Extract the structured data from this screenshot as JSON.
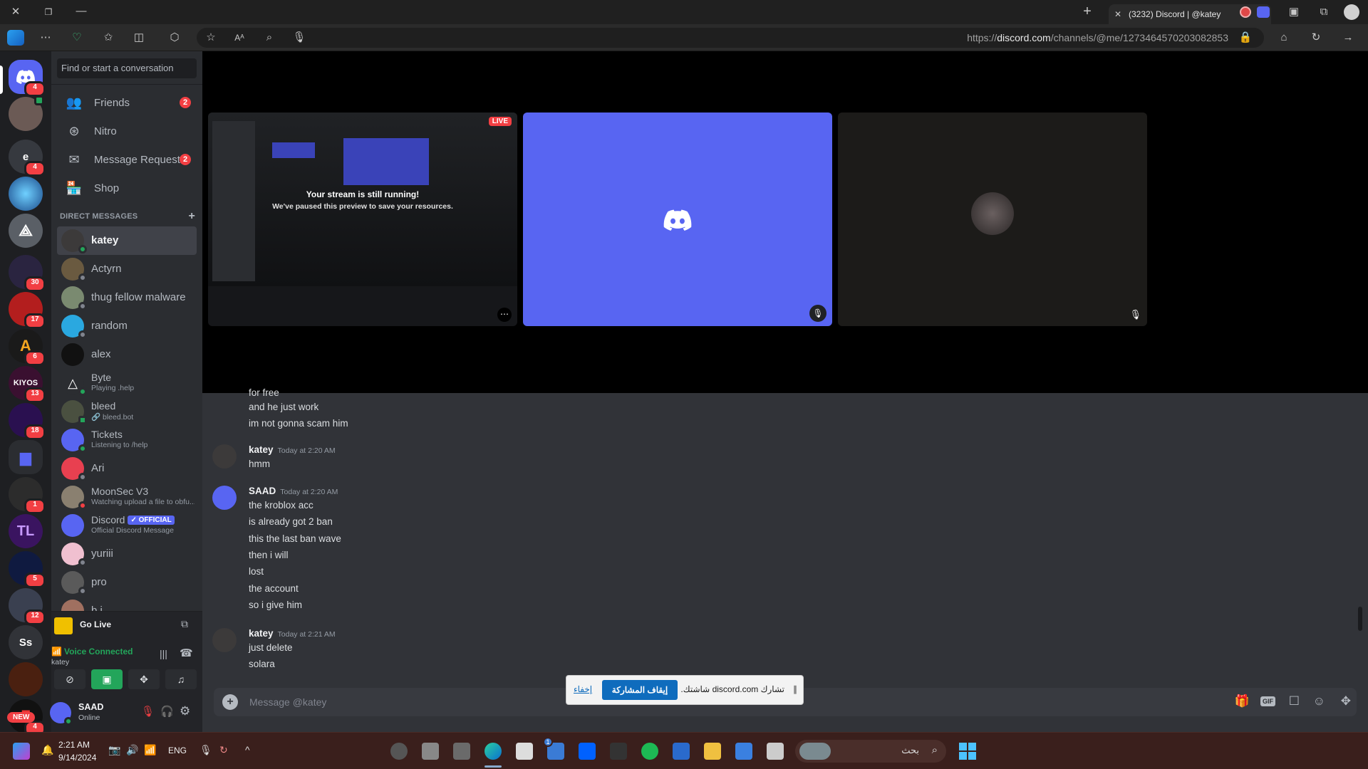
{
  "browser": {
    "tab_title": "(3232) Discord | @katey",
    "url_prefix": "https://",
    "url_domain": "discord.com",
    "url_path": "/channels/@me/1273464570203082853"
  },
  "guild_badges": [
    "4",
    "4",
    "30",
    "17",
    "6",
    "13",
    "18",
    "1",
    "5",
    "12",
    "4"
  ],
  "guild_labels": {
    "e": "e",
    "ss": "Ss",
    "kiyos": "KIYOS",
    "tl": "TL",
    "new": "NEW"
  },
  "sidebar": {
    "search_placeholder": "Find or start a conversation",
    "nav": [
      {
        "label": "Friends",
        "badge": "2"
      },
      {
        "label": "Nitro"
      },
      {
        "label": "Message Requests",
        "badge": "2"
      },
      {
        "label": "Shop"
      }
    ],
    "dm_header": "DIRECT MESSAGES",
    "dms": [
      {
        "name": "katey"
      },
      {
        "name": "Actyrn"
      },
      {
        "name": "thug fellow malware"
      },
      {
        "name": "random"
      },
      {
        "name": "alex"
      },
      {
        "name": "Byte",
        "sub": "Playing .help"
      },
      {
        "name": "bleed",
        "sub": "🔗 bleed.bot"
      },
      {
        "name": "Tickets",
        "sub": "Listening to /help"
      },
      {
        "name": "Ari"
      },
      {
        "name": "MoonSec V3",
        "sub": "Watching upload a file to obfu..."
      },
      {
        "name": "Discord",
        "badge": "✓ OFFICIAL",
        "sub": "Official Discord Message"
      },
      {
        "name": "yuriii"
      },
      {
        "name": "pro"
      },
      {
        "name": "b.i"
      }
    ]
  },
  "golive": {
    "label": "Go Live"
  },
  "voice": {
    "status": "Voice Connected",
    "channel": "katey"
  },
  "user": {
    "name": "SAAD",
    "status": "Online"
  },
  "stage": {
    "live_badge": "LIVE",
    "paused_title": "Your stream is still running!",
    "paused_sub": "We've paused this preview to save your resources."
  },
  "chat": {
    "messages": [
      {
        "text": "for free"
      },
      {
        "text": "and he just work"
      },
      {
        "text": "im not gonna scam him"
      }
    ],
    "groups": [
      {
        "author": "katey",
        "time": "Today at 2:20 AM",
        "lines": [
          "hmm"
        ]
      },
      {
        "author": "SAAD",
        "time": "Today at 2:20 AM",
        "lines": [
          "the kroblox acc",
          "is already got 2 ban",
          "this the last ban wave",
          "then i will",
          "lost",
          "the account",
          "so i give him"
        ]
      },
      {
        "author": "katey",
        "time": "Today at 2:21 AM",
        "lines": [
          "just delete",
          "solara"
        ]
      }
    ],
    "composer_placeholder": "Message @katey"
  },
  "sharebar": {
    "text": "تشارك discord.com شاشتك.",
    "stop_label": "إيقاف المشاركة",
    "hide_label": "إخفاء"
  },
  "taskbar": {
    "time": "2:21 AM",
    "date": "9/14/2024",
    "lang": "ENG",
    "search_placeholder": "بحث",
    "store_badge": "1"
  },
  "colors": {
    "blurple": "#5865f2",
    "online": "#23a55a",
    "danger": "#f23f43"
  }
}
